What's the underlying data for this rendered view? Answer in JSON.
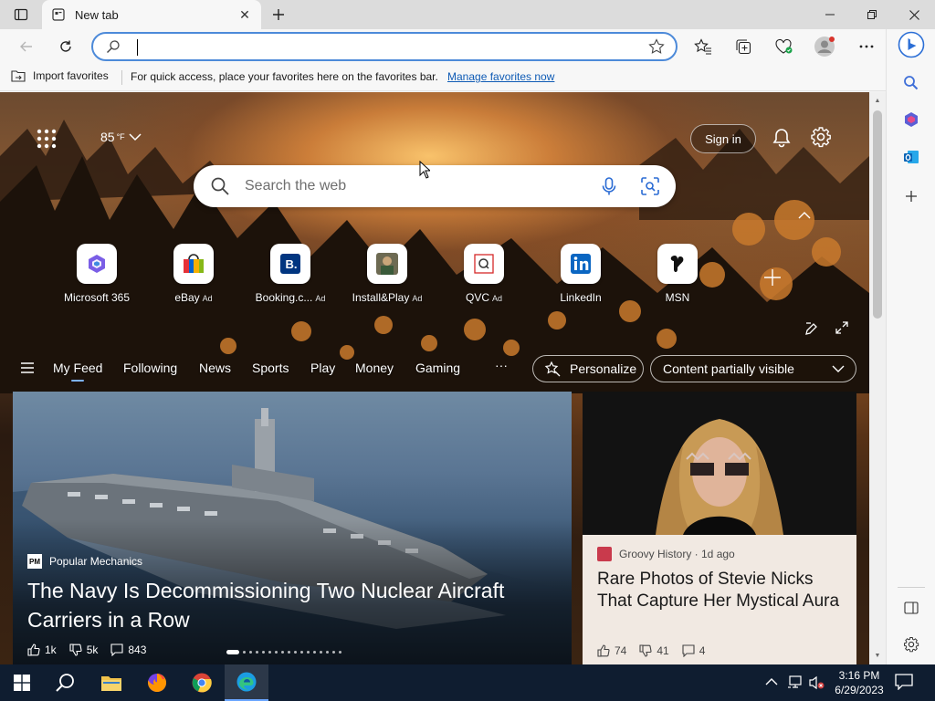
{
  "tab": {
    "title": "New tab"
  },
  "address": {
    "value": "",
    "placeholder": ""
  },
  "favorites_bar": {
    "import_label": "Import favorites",
    "message": "For quick access, place your favorites here on the favorites bar.",
    "manage_link": "Manage favorites now"
  },
  "header": {
    "temperature": "85",
    "temp_unit": "°F",
    "signin_label": "Sign in"
  },
  "search": {
    "placeholder": "Search the web"
  },
  "quicklinks": [
    {
      "label": "Microsoft 365",
      "ad": ""
    },
    {
      "label": "eBay",
      "ad": "Ad"
    },
    {
      "label": "Booking.c...",
      "ad": "Ad"
    },
    {
      "label": "Install&Play",
      "ad": "Ad"
    },
    {
      "label": "QVC",
      "ad": "Ad"
    },
    {
      "label": "LinkedIn",
      "ad": ""
    },
    {
      "label": "MSN",
      "ad": ""
    }
  ],
  "feed_tabs": [
    "My Feed",
    "Following",
    "News",
    "Sports",
    "Play",
    "Money",
    "Gaming"
  ],
  "feed_more": "···",
  "personalize_label": "Personalize",
  "content_select": "Content partially visible",
  "card_main": {
    "source": "Popular Mechanics",
    "title": "The Navy Is Decommissioning Two Nuclear Aircraft Carriers in a Row",
    "likes": "1k",
    "dislikes": "5k",
    "comments": "843"
  },
  "card_side": {
    "source": "Groovy History · 1d ago",
    "title": "Rare Photos of Stevie Nicks That Capture Her Mystical Aura",
    "likes": "74",
    "dislikes": "41",
    "comments": "4"
  },
  "taskbar": {
    "time": "3:16 PM",
    "date": "6/29/2023"
  },
  "colors": {
    "accent": "#0f5bb5",
    "address_border": "#4d8ad9",
    "taskbar": "#0f1d30"
  }
}
